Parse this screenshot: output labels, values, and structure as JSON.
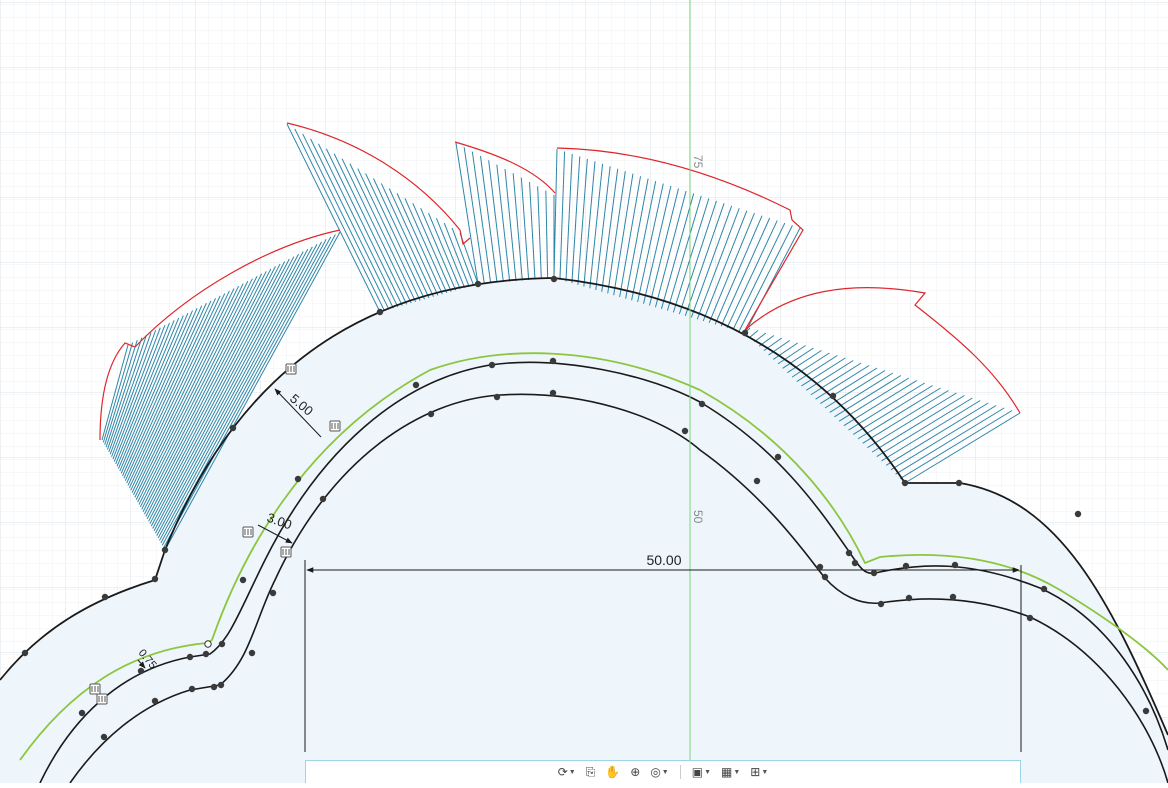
{
  "dimensions": {
    "outer_offset": "5.00",
    "inner_offset": "3.00",
    "small_offset": "0.75",
    "width": "50.00"
  },
  "axis_labels": {
    "y_axis_upper": "75",
    "y_axis_lower": "50"
  },
  "navigation_bar": {
    "tools": [
      {
        "name": "orbit-icon",
        "glyph": "⟳"
      },
      {
        "name": "look-at-icon",
        "glyph": "⎘"
      },
      {
        "name": "pan-icon",
        "glyph": "✋"
      },
      {
        "name": "zoom-icon",
        "glyph": "⊕"
      },
      {
        "name": "fit-icon",
        "glyph": "◎"
      },
      {
        "name": "display-settings-icon",
        "glyph": "▣"
      },
      {
        "name": "grid-settings-icon",
        "glyph": "▦"
      },
      {
        "name": "viewports-icon",
        "glyph": "⊞"
      }
    ]
  },
  "colors": {
    "background": "#ffffff",
    "grid_minor": "#eef1f4",
    "grid_major": "#dde3ea",
    "profile_fill": "#eef6fc",
    "sketch_curve": "#1a1a1a",
    "offset_curve": "#8cc63f",
    "hatch": "#2e86a8",
    "boundary": "#e0262b",
    "axis": "#7bd67b"
  }
}
